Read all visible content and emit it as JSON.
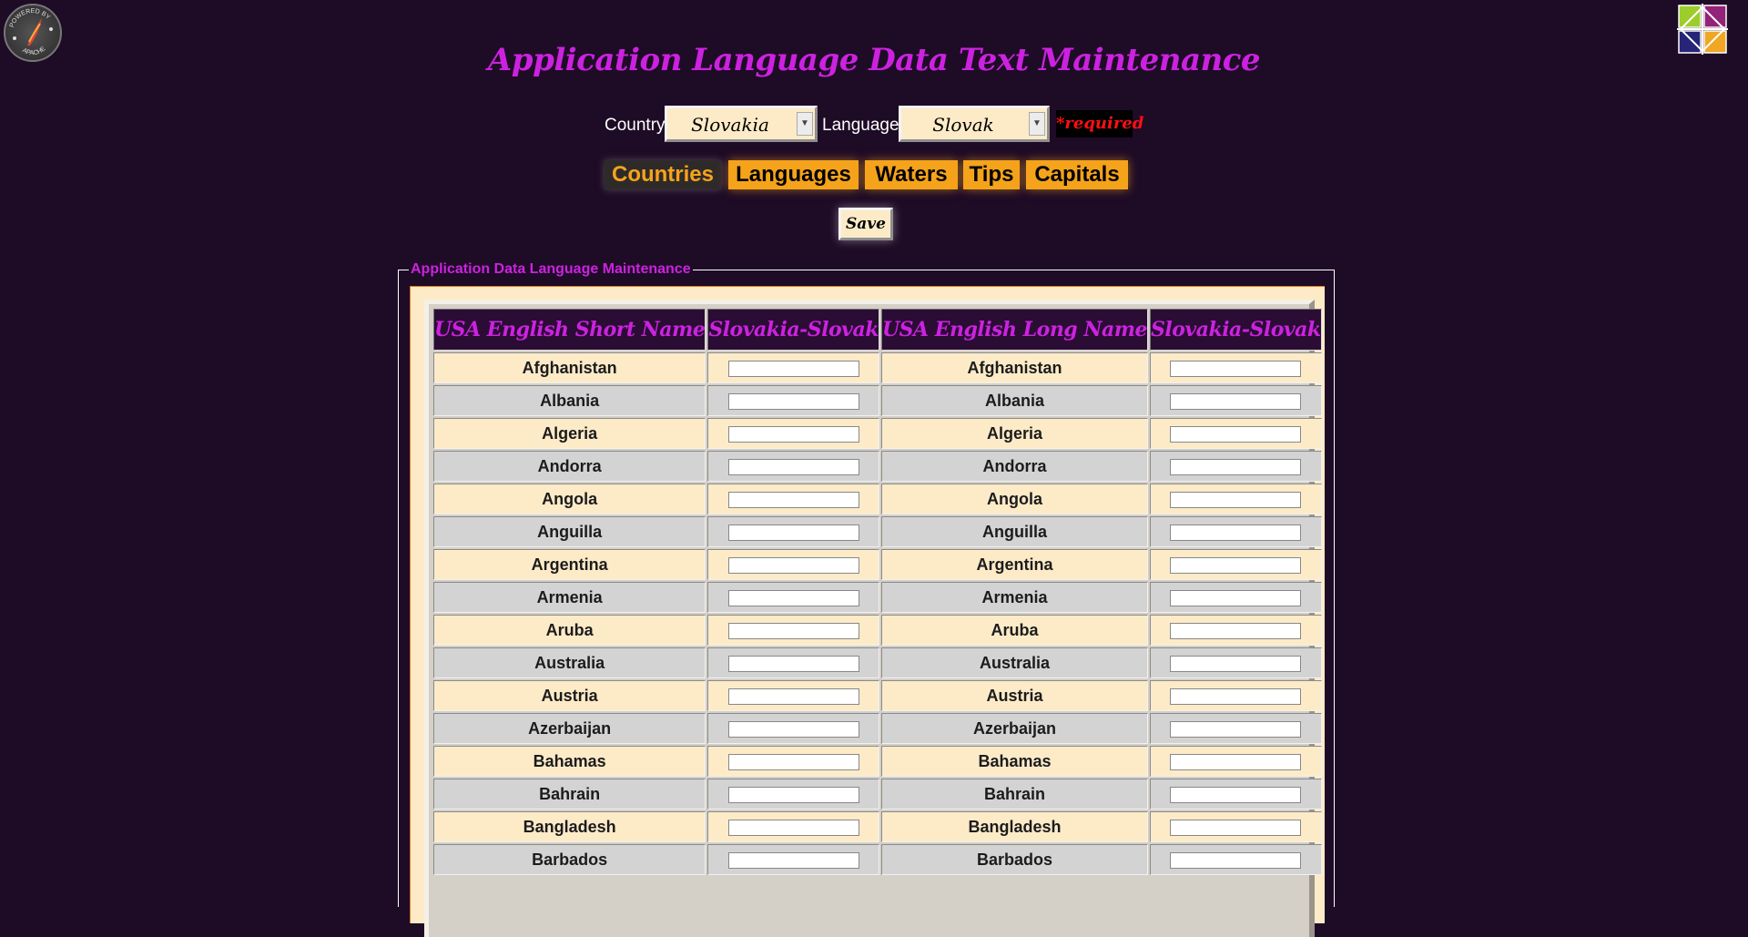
{
  "badges": {
    "apache_text": "POWERED BY APACHE"
  },
  "title": "Application Language Data Text Maintenance",
  "selectors": {
    "country_label": "Country",
    "country_value": "Slovakia",
    "language_label": "Language",
    "language_value": "Slovak",
    "required_text": "*required"
  },
  "tabs": [
    {
      "label": "Countries",
      "active": true
    },
    {
      "label": "Languages",
      "active": false
    },
    {
      "label": "Waters",
      "active": false
    },
    {
      "label": "Tips",
      "active": false
    },
    {
      "label": "Capitals",
      "active": false
    }
  ],
  "save_label": "Save",
  "fieldset_legend": "Application Data Language Maintenance",
  "table": {
    "headers": [
      "USA English Short Name",
      "Slovakia-Slovak",
      "USA English Long Name",
      "Slovakia-Slovak"
    ],
    "rows": [
      {
        "short": "Afghanistan",
        "short_value": "",
        "long": "Afghanistan",
        "long_value": ""
      },
      {
        "short": "Albania",
        "short_value": "",
        "long": "Albania",
        "long_value": ""
      },
      {
        "short": "Algeria",
        "short_value": "",
        "long": "Algeria",
        "long_value": ""
      },
      {
        "short": "Andorra",
        "short_value": "",
        "long": "Andorra",
        "long_value": ""
      },
      {
        "short": "Angola",
        "short_value": "",
        "long": "Angola",
        "long_value": ""
      },
      {
        "short": "Anguilla",
        "short_value": "",
        "long": "Anguilla",
        "long_value": ""
      },
      {
        "short": "Argentina",
        "short_value": "",
        "long": "Argentina",
        "long_value": ""
      },
      {
        "short": "Armenia",
        "short_value": "",
        "long": "Armenia",
        "long_value": ""
      },
      {
        "short": "Aruba",
        "short_value": "",
        "long": "Aruba",
        "long_value": ""
      },
      {
        "short": "Australia",
        "short_value": "",
        "long": "Australia",
        "long_value": ""
      },
      {
        "short": "Austria",
        "short_value": "",
        "long": "Austria",
        "long_value": ""
      },
      {
        "short": "Azerbaijan",
        "short_value": "",
        "long": "Azerbaijan",
        "long_value": ""
      },
      {
        "short": "Bahamas",
        "short_value": "",
        "long": "Bahamas",
        "long_value": ""
      },
      {
        "short": "Bahrain",
        "short_value": "",
        "long": "Bahrain",
        "long_value": ""
      },
      {
        "short": "Bangladesh",
        "short_value": "",
        "long": "Bangladesh",
        "long_value": ""
      },
      {
        "short": "Barbados",
        "short_value": "",
        "long": "Barbados",
        "long_value": ""
      }
    ]
  },
  "colors": {
    "background": "#1e0b26",
    "title": "#cc22e0",
    "tab": "#f5a31b",
    "tab_active_bg": "#2f2a2a",
    "required": "#ff1010",
    "row_odd": "#fdebc8",
    "row_even": "#d3d3d3"
  }
}
